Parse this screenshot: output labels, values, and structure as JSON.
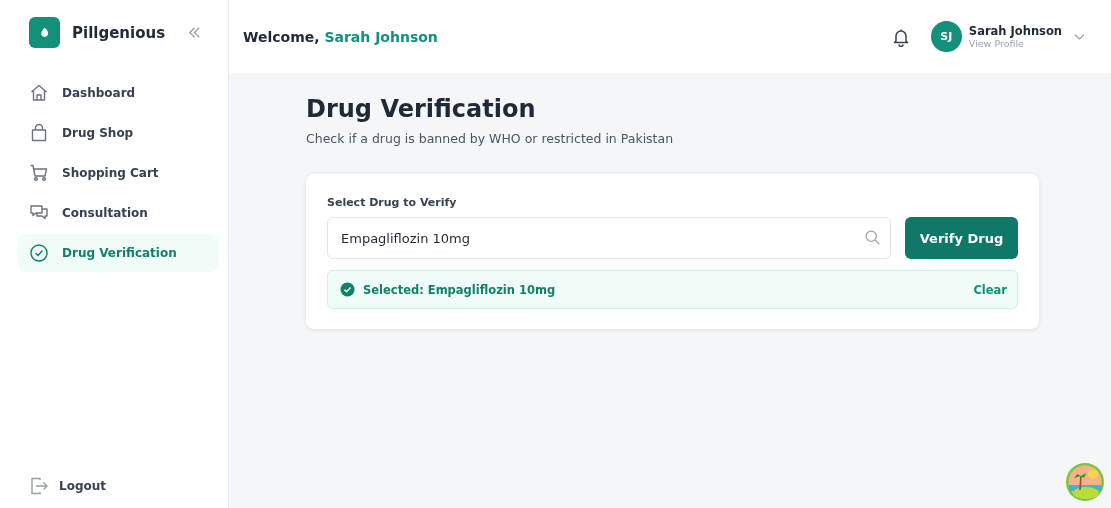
{
  "brand": {
    "name": "Pillgenious"
  },
  "sidebar": {
    "items": [
      {
        "label": "Dashboard",
        "kind": "home",
        "selected": false
      },
      {
        "label": "Drug Shop",
        "kind": "bag",
        "selected": false
      },
      {
        "label": "Shopping Cart",
        "kind": "cart",
        "selected": false
      },
      {
        "label": "Consultation",
        "kind": "chat",
        "selected": false
      },
      {
        "label": "Drug Verification",
        "kind": "check",
        "selected": true
      }
    ],
    "logout": "Logout"
  },
  "header": {
    "greeting": "Welcome,",
    "name": "Sarah Johnson",
    "user": {
      "initials": "SJ",
      "name": "Sarah Johnson",
      "link": "View Profile"
    }
  },
  "page": {
    "title": "Drug Verification",
    "subtitle": "Check if a drug is banned by WHO or restricted in Pakistan"
  },
  "form": {
    "label": "Select Drug to Verify",
    "value": "Empagliflozin 10mg",
    "button": "Verify Drug",
    "selection": "Selected: Empagliflozin 10mg",
    "clear": "Clear"
  }
}
